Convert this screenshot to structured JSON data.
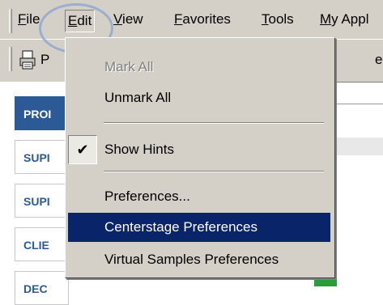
{
  "menubar": {
    "items": [
      {
        "label": "File",
        "mnemonic": "F",
        "rest": "ile"
      },
      {
        "label": "Edit",
        "mnemonic": "E",
        "rest": "dit"
      },
      {
        "label": "View",
        "mnemonic": "V",
        "rest": "iew"
      },
      {
        "label": "Favorites",
        "mnemonic": "F",
        "rest": "avorites"
      },
      {
        "label": "Tools",
        "mnemonic": "T",
        "rest": "ools"
      },
      {
        "label": "My Appl",
        "mnemonic": "M",
        "rest": "y Appl"
      }
    ]
  },
  "toolbar": {
    "left_label": "P",
    "right_label": "e",
    "icon": "print-icon"
  },
  "nav": {
    "items": [
      {
        "label": "PROI",
        "selected": true
      },
      {
        "label": "SUPI"
      },
      {
        "label": "SUPI"
      },
      {
        "label": "CLIE"
      },
      {
        "label": "DEC"
      }
    ]
  },
  "edit_menu": {
    "items": [
      {
        "label": "Mark All",
        "state": "disabled"
      },
      {
        "label": "Unmark All"
      },
      {
        "label": "Show Hints",
        "checked": true
      },
      {
        "label": "Preferences..."
      },
      {
        "label": "Centerstage Preferences",
        "state": "highlighted"
      },
      {
        "label": "Virtual Samples Preferences"
      }
    ],
    "check_mark": "✔"
  },
  "colors": {
    "chrome": "#d4d0c8",
    "highlight": "#0a246a",
    "nav_blue": "#2b5a97",
    "annotation_circle": "#8fa9cf"
  }
}
